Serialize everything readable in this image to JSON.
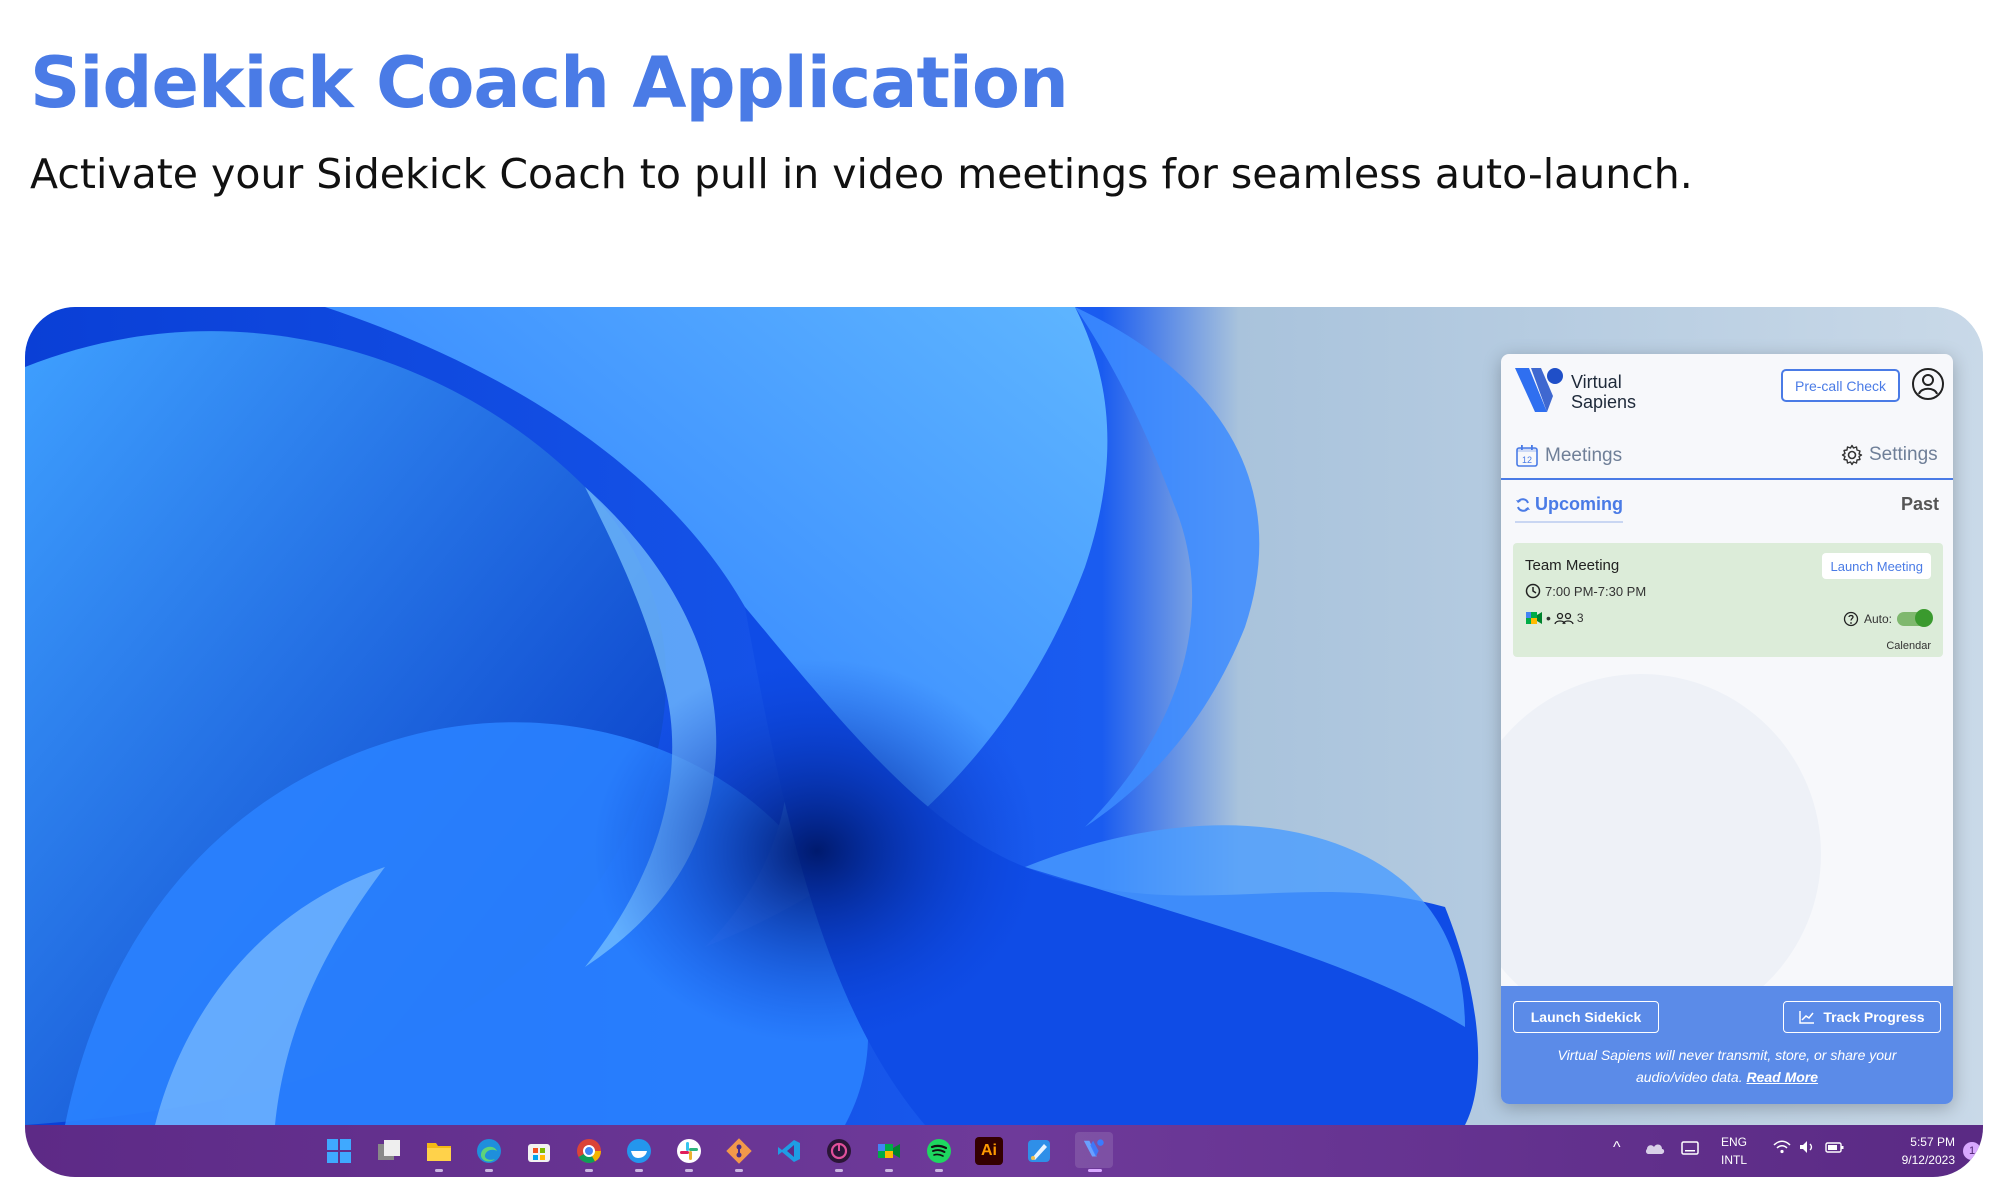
{
  "header": {
    "title": "Sidekick Coach Application",
    "subtitle": "Activate your Sidekick Coach to pull in video meetings for seamless auto-launch."
  },
  "colors": {
    "accent": "#4a7be6",
    "footer": "#5b8be8",
    "card_bg": "#dcecd9",
    "toggle_on": "#3a9a2e",
    "taskbar": "#62318f"
  },
  "panel": {
    "brand_line1": "Virtual",
    "brand_line2": "Sapiens",
    "precall_label": "Pre-call Check",
    "account_icon": "user-circle-icon",
    "nav": {
      "meetings_label": "Meetings",
      "calendar_icon_day": "12",
      "settings_label": "Settings"
    },
    "subtabs": {
      "upcoming_label": "Upcoming",
      "past_label": "Past"
    },
    "meeting": {
      "title": "Team Meeting",
      "time": "7:00 PM-7:30 PM",
      "attendees": "3",
      "launch_label": "Launch Meeting",
      "auto_label": "Auto:",
      "auto_enabled": true,
      "source": "Calendar"
    },
    "footer": {
      "launch_sidekick_label": "Launch Sidekick",
      "track_progress_label": "Track Progress",
      "privacy_text": "Virtual Sapiens will never transmit, store, or share your audio/video data.",
      "read_more_label": "Read More"
    }
  },
  "taskbar": {
    "apps": [
      {
        "name": "start-icon"
      },
      {
        "name": "task-view-icon"
      },
      {
        "name": "file-explorer-icon"
      },
      {
        "name": "edge-icon"
      },
      {
        "name": "store-icon"
      },
      {
        "name": "chrome-icon"
      },
      {
        "name": "docker-icon"
      },
      {
        "name": "slack-icon"
      },
      {
        "name": "git-icon"
      },
      {
        "name": "vscode-icon"
      },
      {
        "name": "power-app-icon"
      },
      {
        "name": "google-meet-icon"
      },
      {
        "name": "spotify-icon"
      },
      {
        "name": "illustrator-icon",
        "label": "Ai"
      },
      {
        "name": "paint-icon"
      },
      {
        "name": "virtual-sapiens-icon"
      }
    ],
    "tray": {
      "lang_line1": "ENG",
      "lang_line2": "INTL",
      "time": "5:57 PM",
      "date": "9/12/2023",
      "notifications": "1"
    }
  }
}
